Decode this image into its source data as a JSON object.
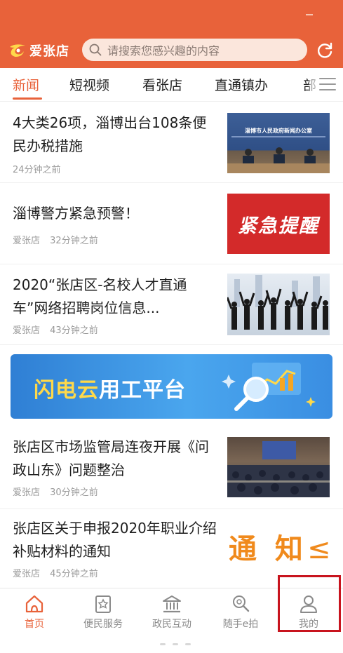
{
  "app": {
    "logo_text": "爱张店",
    "brand_color": "#e8623a"
  },
  "search": {
    "placeholder": "请搜索您感兴趣的内容"
  },
  "tabs": [
    {
      "label": "新闻",
      "active": true
    },
    {
      "label": "短视频",
      "active": false
    },
    {
      "label": "看张店",
      "active": false
    },
    {
      "label": "直通镇办",
      "active": false
    },
    {
      "label": "部",
      "active": false
    }
  ],
  "articles": [
    {
      "title": "4大类26项，淄博出台108条便民办税措施",
      "source": "",
      "time": "24分钟之前",
      "thumb": "press-conference-photo",
      "thumb_caption": "淄博市人民政府新闻办公室"
    },
    {
      "title": "淄博警方紧急预警！",
      "source": "爱张店",
      "time": "32分钟之前",
      "thumb": "urgent-alert-image",
      "thumb_text": "紧急提醒"
    },
    {
      "title": "2020“张店区-名校人才直通车”网络招聘岗位信息...",
      "source": "爱张店",
      "time": "43分钟之前",
      "thumb": "crowd-silhouette-image"
    },
    {
      "title": "张店区市场监管局连夜开展《问政山东》问题整治",
      "source": "爱张店",
      "time": "30分钟之前",
      "thumb": "meeting-room-photo"
    },
    {
      "title": "张店区关于申报2020年职业介绍补贴材料的通知",
      "source": "爱张店",
      "time": "45分钟之前",
      "thumb": "notice-image",
      "thumb_text": "通 知"
    }
  ],
  "banner": {
    "text_yellow": "闪电云",
    "text_white": "用工平台"
  },
  "bottom_nav": [
    {
      "label": "首页",
      "icon": "home-icon",
      "active": true
    },
    {
      "label": "便民服务",
      "icon": "star-book-icon",
      "active": false
    },
    {
      "label": "政民互动",
      "icon": "government-building-icon",
      "active": false
    },
    {
      "label": "随手e拍",
      "icon": "camera-search-icon",
      "active": false
    },
    {
      "label": "我的",
      "icon": "user-icon",
      "active": false
    }
  ]
}
